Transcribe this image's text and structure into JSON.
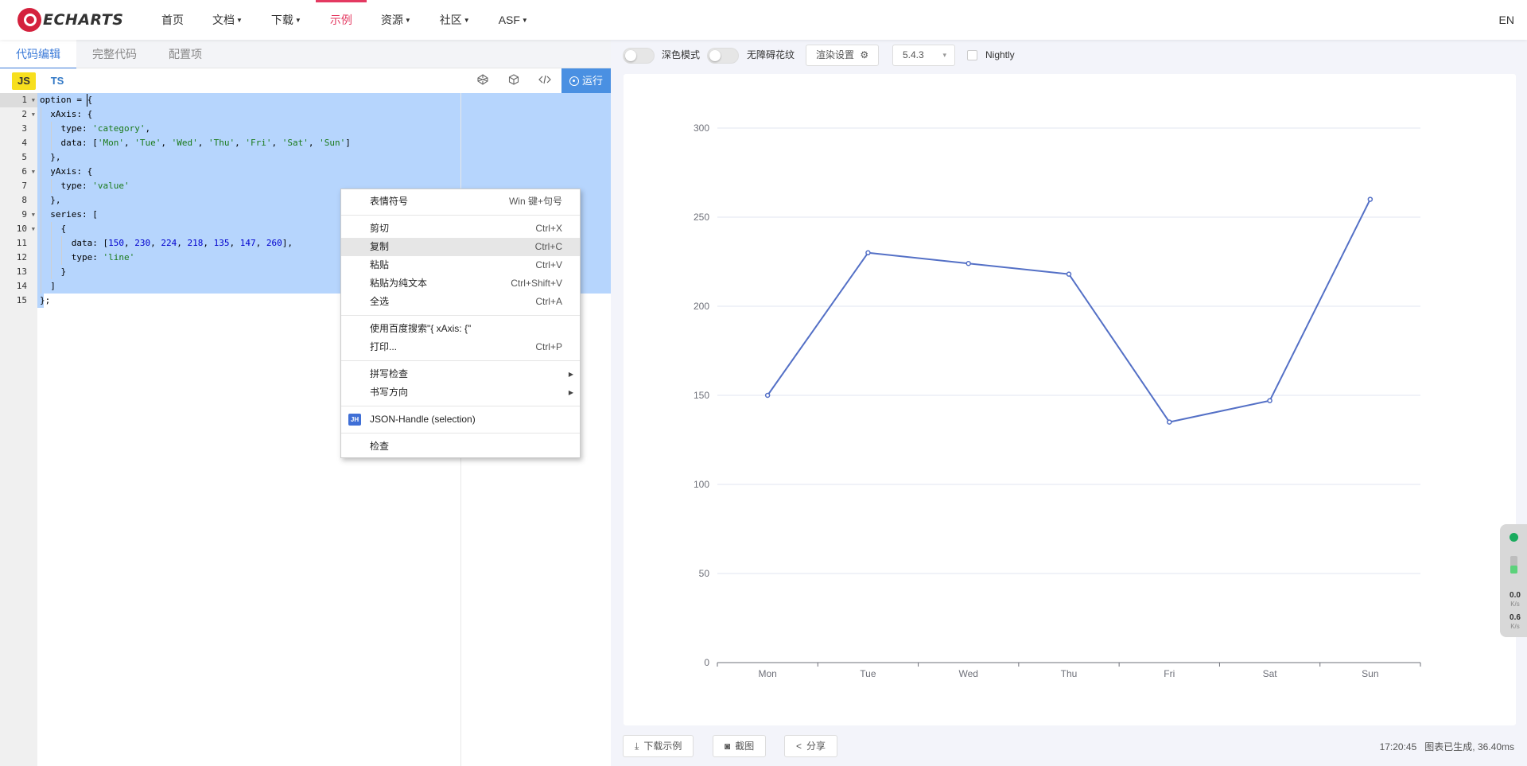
{
  "nav": {
    "logo_text": "ECHARTS",
    "items": [
      {
        "label": "首页",
        "caret": false,
        "active": false
      },
      {
        "label": "文档",
        "caret": true,
        "active": false
      },
      {
        "label": "下载",
        "caret": true,
        "active": false
      },
      {
        "label": "示例",
        "caret": false,
        "active": true
      },
      {
        "label": "资源",
        "caret": true,
        "active": false
      },
      {
        "label": "社区",
        "caret": true,
        "active": false
      },
      {
        "label": "ASF",
        "caret": true,
        "active": false
      }
    ],
    "lang": "EN"
  },
  "editor": {
    "tabs": [
      "代码编辑",
      "完整代码",
      "配置项"
    ],
    "active_tab": 0,
    "lang_js": "JS",
    "lang_ts": "TS",
    "run_label": "运行",
    "lines": [
      "option = {",
      "  xAxis: {",
      "    type: 'category',",
      "    data: ['Mon', 'Tue', 'Wed', 'Thu', 'Fri', 'Sat', 'Sun']",
      "  },",
      "  yAxis: {",
      "    type: 'value'",
      "  },",
      "  series: [",
      "    {",
      "      data: [150, 230, 224, 218, 135, 147, 260],",
      "      type: 'line'",
      "    }",
      "  ]",
      "};"
    ],
    "foldable_lines": [
      1,
      2,
      6,
      9,
      10
    ]
  },
  "context_menu": {
    "groups": [
      [
        {
          "label": "表情符号",
          "shortcut": "Win 键+句号"
        }
      ],
      [
        {
          "label": "剪切",
          "shortcut": "Ctrl+X"
        },
        {
          "label": "复制",
          "shortcut": "Ctrl+C",
          "hover": true
        },
        {
          "label": "粘贴",
          "shortcut": "Ctrl+V"
        },
        {
          "label": "粘贴为纯文本",
          "shortcut": "Ctrl+Shift+V"
        },
        {
          "label": "全选",
          "shortcut": "Ctrl+A"
        }
      ],
      [
        {
          "label": "使用百度搜索\"{    xAxis: {\"",
          "shortcut": ""
        },
        {
          "label": "打印...",
          "shortcut": "Ctrl+P"
        }
      ],
      [
        {
          "label": "拼写检查",
          "shortcut": "",
          "submenu": true
        },
        {
          "label": "书写方向",
          "shortcut": "",
          "submenu": true
        }
      ],
      [
        {
          "label": "JSON-Handle (selection)",
          "shortcut": "",
          "icon": "JH"
        }
      ],
      [
        {
          "label": "检查",
          "shortcut": ""
        }
      ]
    ]
  },
  "preview_toolbar": {
    "dark_mode": "深色模式",
    "aria_pattern": "无障碍花纹",
    "render_settings": "渲染设置",
    "version": "5.4.3",
    "nightly": "Nightly"
  },
  "bottom_bar": {
    "download": "下载示例",
    "screenshot": "截图",
    "share": "分享",
    "time": "17:20:45",
    "status": "图表已生成, 36.40ms"
  },
  "side_widget": {
    "upload": "0.0",
    "upload_unit": "K/s",
    "download": "0.6",
    "download_unit": "K/s"
  },
  "colors": {
    "accent": "#e43961",
    "run_button": "#4a90e2",
    "series": "#5470c6",
    "selection": "#b6d5fd"
  },
  "chart_data": {
    "type": "line",
    "categories": [
      "Mon",
      "Tue",
      "Wed",
      "Thu",
      "Fri",
      "Sat",
      "Sun"
    ],
    "values": [
      150,
      230,
      224,
      218,
      135,
      147,
      260
    ],
    "yticks": [
      0,
      50,
      100,
      150,
      200,
      250,
      300
    ],
    "ylim": [
      0,
      300
    ],
    "grid": true,
    "legend": "none"
  }
}
